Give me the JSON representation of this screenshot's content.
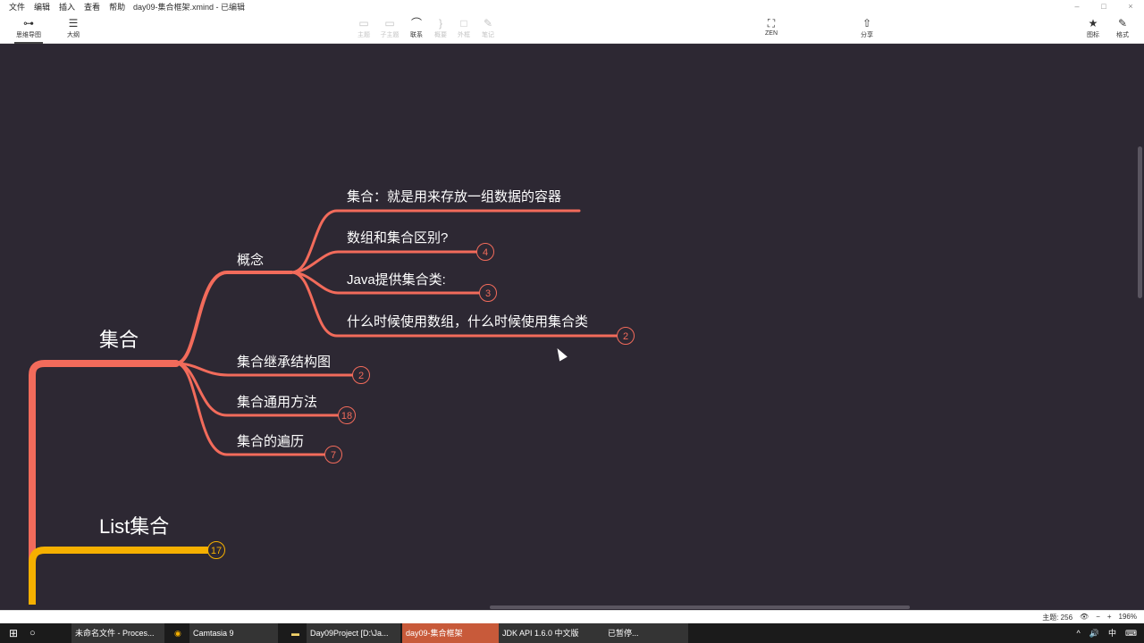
{
  "menu": [
    "文件",
    "编辑",
    "插入",
    "查看",
    "帮助"
  ],
  "document": {
    "title": "day09-集合框架.xmind - 已编辑"
  },
  "window_controls": [
    "–",
    "□",
    "×"
  ],
  "view_tabs": [
    {
      "label": "思维导图",
      "icon": "mindmap-icon",
      "glyph": "⊶",
      "active": true
    },
    {
      "label": "大纲",
      "icon": "outline-icon",
      "glyph": "☰",
      "active": false
    }
  ],
  "toolbar": [
    {
      "label": "主题",
      "icon": "topic-icon",
      "glyph": "▭",
      "enabled": false
    },
    {
      "label": "子主题",
      "icon": "subtopic-icon",
      "glyph": "▭",
      "enabled": false
    },
    {
      "label": "联系",
      "icon": "relationship-icon",
      "glyph": "⌒",
      "enabled": true
    },
    {
      "label": "概要",
      "icon": "summary-icon",
      "glyph": "}",
      "enabled": false
    },
    {
      "label": "外框",
      "icon": "boundary-icon",
      "glyph": "□",
      "enabled": false
    },
    {
      "label": "笔记",
      "icon": "notes-icon",
      "glyph": "✎",
      "enabled": false
    }
  ],
  "zen": {
    "label": "ZEN",
    "glyph": "⛶"
  },
  "share": {
    "label": "分享",
    "glyph": "⇧"
  },
  "right_panels": [
    {
      "label": "图标",
      "glyph": "★"
    },
    {
      "label": "格式",
      "glyph": "✎"
    }
  ],
  "mindmap": {
    "branch_color": "#f26b5b",
    "second_branch_color": "#f5b000",
    "topics": [
      {
        "label": "集合",
        "children": [
          {
            "label": "概念",
            "children": [
              {
                "label": "集合：就是用来存放一组数据的容器",
                "count": ""
              },
              {
                "label": "数组和集合区别?",
                "count": "4"
              },
              {
                "label": "Java提供集合类:",
                "count": "3"
              },
              {
                "label": "什么时候使用数组，什么时候使用集合类",
                "count": "2"
              }
            ]
          },
          {
            "label": "集合继承结构图",
            "count": "2"
          },
          {
            "label": "集合通用方法",
            "count": "18"
          },
          {
            "label": "集合的遍历",
            "count": "7"
          }
        ]
      },
      {
        "label": "List集合",
        "count": "17"
      }
    ]
  },
  "status": {
    "topic_count": "主题: 256",
    "zoom": "196%",
    "zoom_out": "−",
    "zoom_in": "+"
  },
  "taskbar": {
    "items": [
      {
        "label": "未命名文件 - Proces...",
        "icon": "chrome-icon"
      },
      {
        "label": "Camtasia 9",
        "icon": "camtasia-icon"
      },
      {
        "label": "Day09Project [D:\\Ja...",
        "icon": "folder-icon"
      },
      {
        "label": "day09-集合框架",
        "icon": "xmind-icon"
      },
      {
        "label": "JDK API 1.6.0 中文版",
        "icon": "help-icon"
      },
      {
        "label": "已暂停...",
        "icon": ""
      }
    ],
    "tray": [
      "^",
      "🔊",
      "中",
      "⌨"
    ]
  }
}
